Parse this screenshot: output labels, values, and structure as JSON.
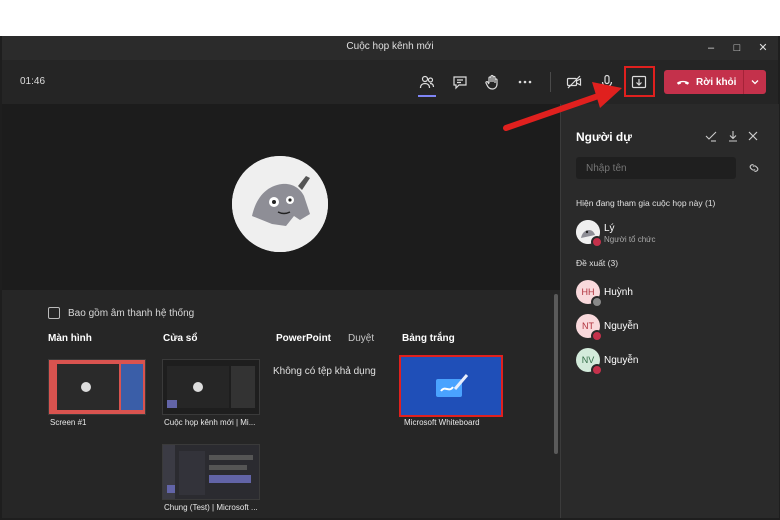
{
  "window": {
    "title": "Cuộc họp kênh mới"
  },
  "toolbar": {
    "timer": "01:46",
    "leave_label": "Rời khỏi"
  },
  "share_tray": {
    "include_audio": "Bao gồm âm thanh hệ thống",
    "sections": {
      "screen": "Màn hình",
      "window": "Cửa sổ",
      "powerpoint": "PowerPoint",
      "browse": "Duyệt",
      "whiteboard": "Bảng trắng"
    },
    "screen_caption": "Screen #1",
    "window_captions": [
      "Cuộc họp kênh mới | Mi...",
      "Chung (Test) | Microsoft ..."
    ],
    "no_files": "Không có tệp khả dụng",
    "whiteboard_caption": "Microsoft Whiteboard"
  },
  "participants": {
    "title": "Người dự",
    "search_placeholder": "Nhập tên",
    "in_meeting_header": "Hiện đang tham gia cuộc họp này (1)",
    "suggested_header": "Đề xuất (3)",
    "in_meeting": [
      {
        "name": "Lý",
        "role": "Người tổ chức"
      }
    ],
    "suggested": [
      {
        "initials": "HH",
        "name": "Huỳnh",
        "bg": "#f9d9dc",
        "fg": "#b0303c",
        "status": "#888888"
      },
      {
        "initials": "NT",
        "name": "Nguyễn",
        "bg": "#f9d9dc",
        "fg": "#b0303c",
        "status": "#c4314b"
      },
      {
        "initials": "NV",
        "name": "Nguyễn",
        "bg": "#d3ebdb",
        "fg": "#2f6b44",
        "status": "#c4314b"
      }
    ]
  },
  "colors": {
    "accent_red": "#c4314b",
    "annotation_red": "#e0201e",
    "whiteboard_blue": "#1f4fb8"
  }
}
